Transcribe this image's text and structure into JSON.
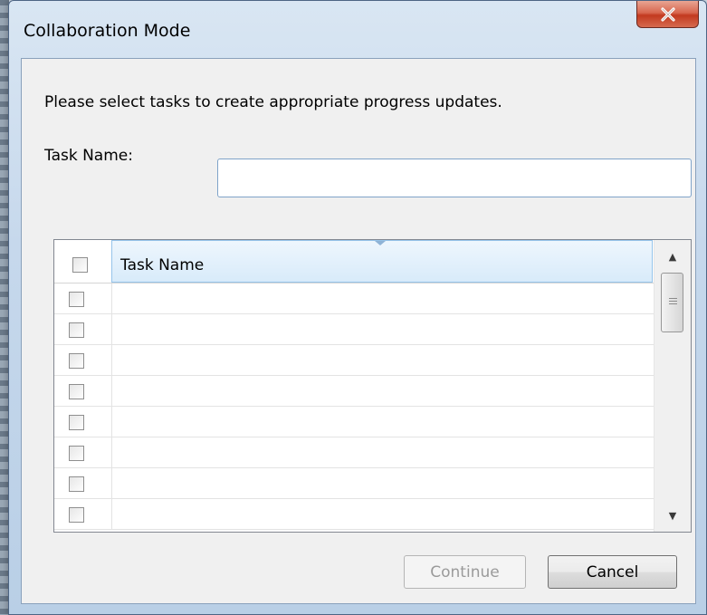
{
  "window": {
    "title": "Collaboration Mode",
    "close_label": "✕"
  },
  "dialog": {
    "instruction": "Please select tasks to create appropriate progress updates.",
    "task_name_label": "Task Name:",
    "task_name_value": ""
  },
  "grid": {
    "column_header": "Task Name",
    "rows": [
      {
        "checked": false,
        "task_name": ""
      },
      {
        "checked": false,
        "task_name": ""
      },
      {
        "checked": false,
        "task_name": ""
      },
      {
        "checked": false,
        "task_name": ""
      },
      {
        "checked": false,
        "task_name": ""
      },
      {
        "checked": false,
        "task_name": ""
      },
      {
        "checked": false,
        "task_name": ""
      },
      {
        "checked": false,
        "task_name": ""
      }
    ]
  },
  "scrollbar": {
    "up_arrow": "▲",
    "down_arrow": "▼"
  },
  "buttons": {
    "continue_label": "Continue",
    "continue_enabled": false,
    "cancel_label": "Cancel"
  },
  "colors": {
    "close_button": "#c2391f",
    "header_highlight": "#d8ebfa",
    "input_border": "#7fa3c9"
  }
}
